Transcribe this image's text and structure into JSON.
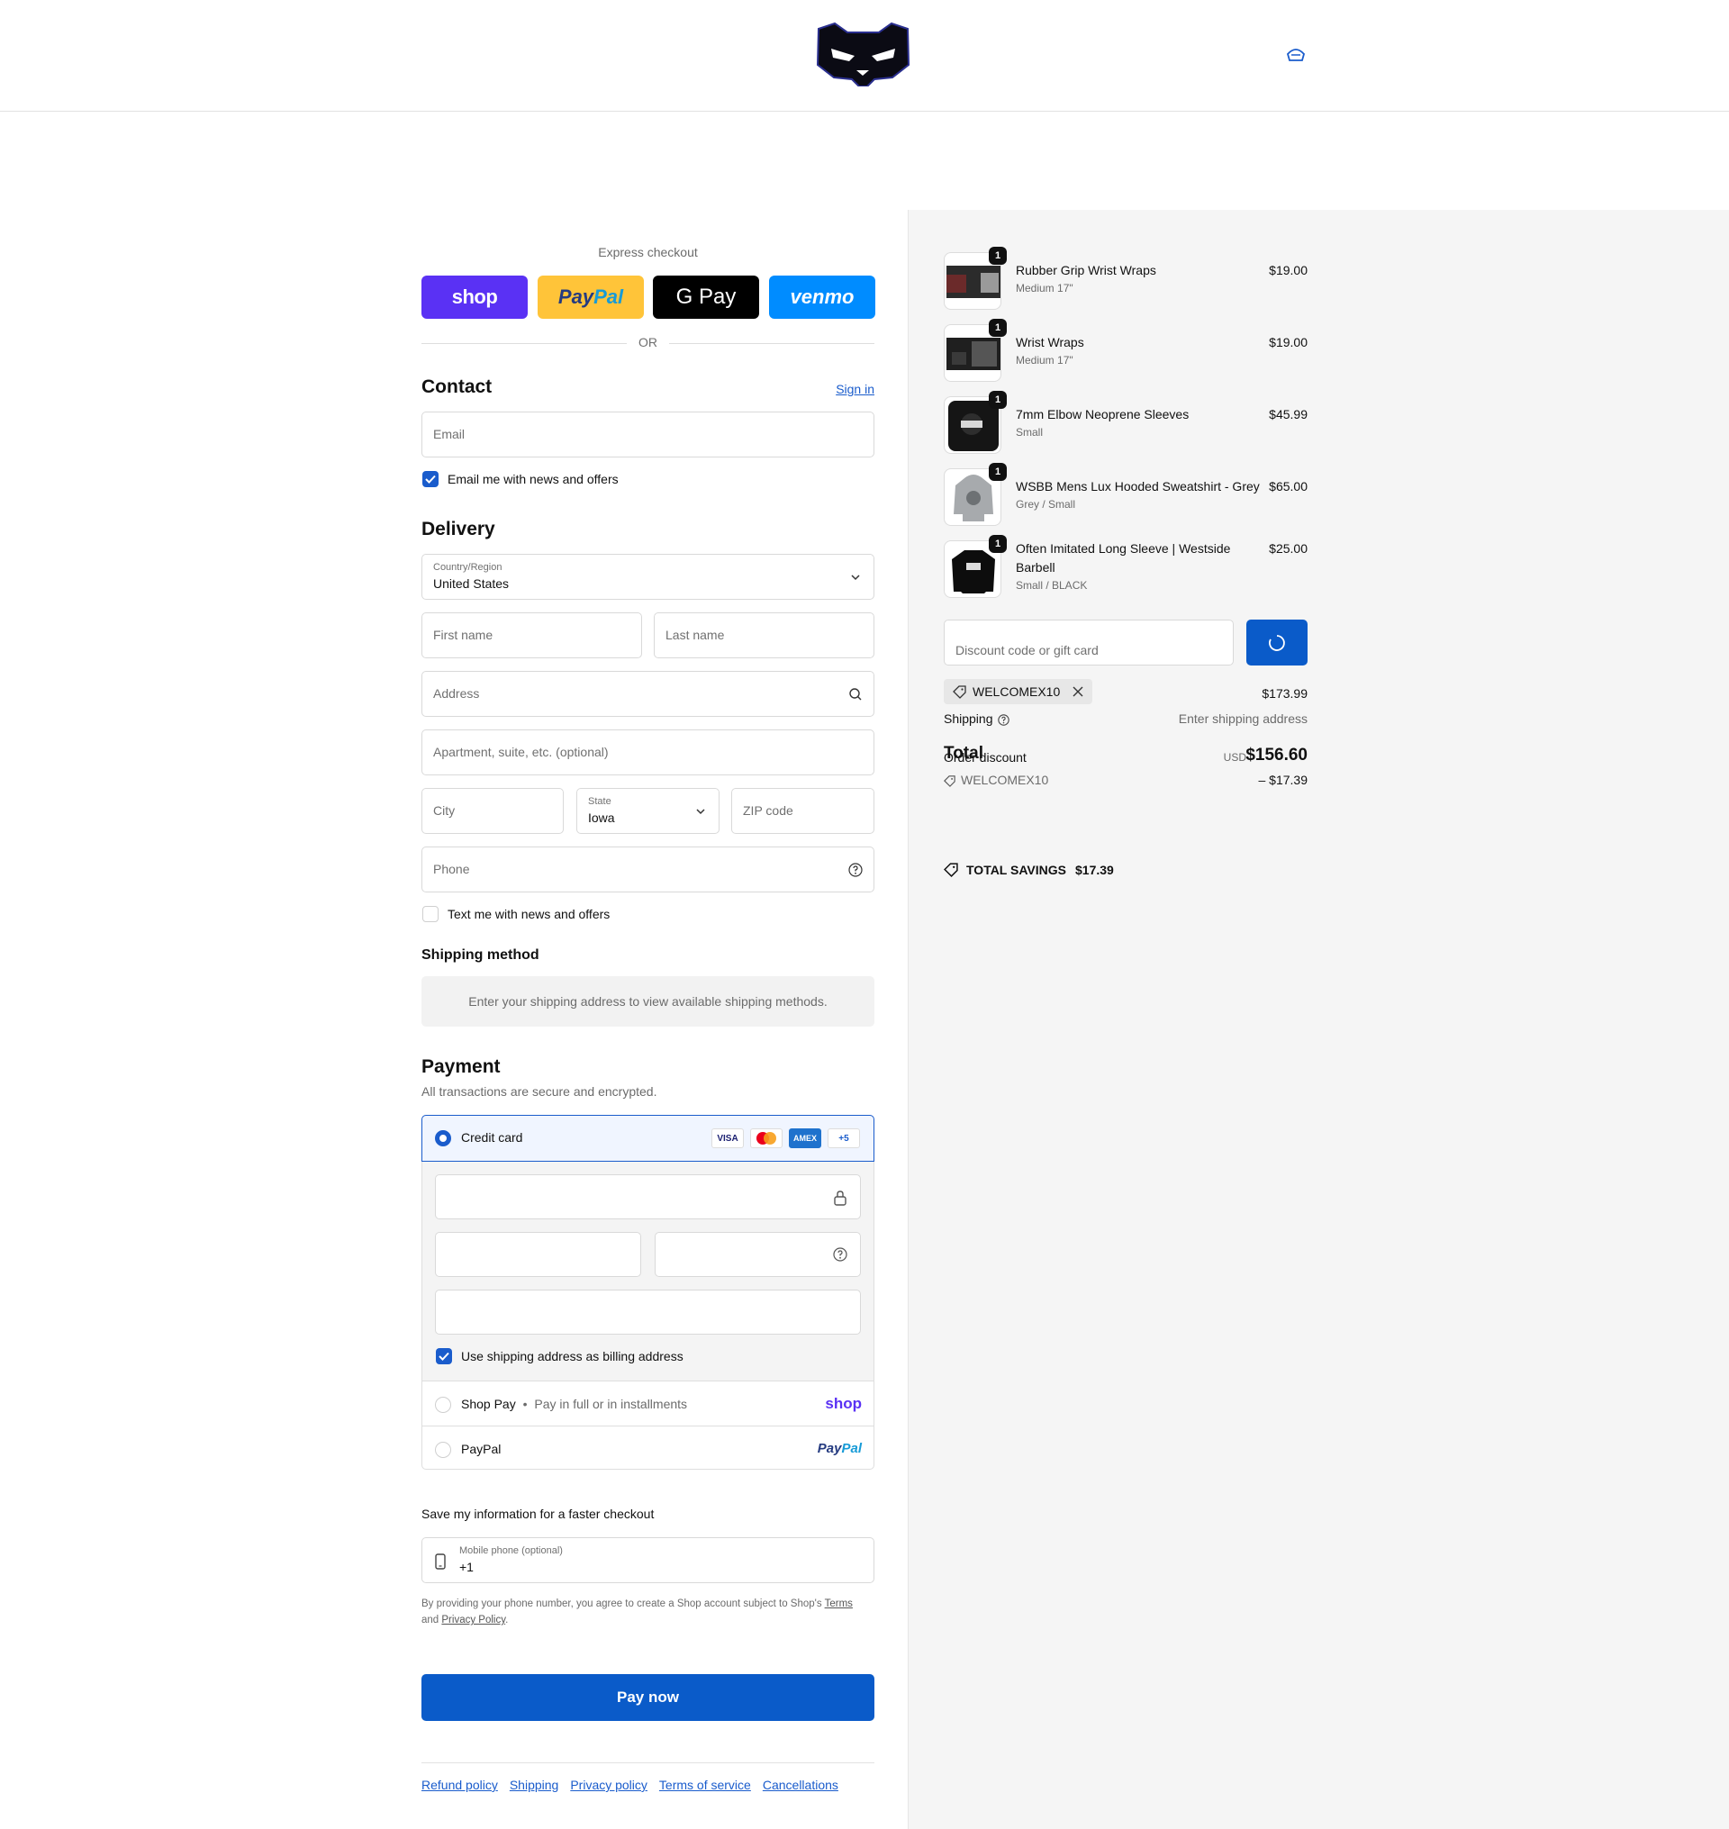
{
  "header": {
    "logo_icon": "panther-mask-logo",
    "cart_icon": "bag-icon"
  },
  "express": {
    "label": "Express checkout",
    "buttons": [
      "shop",
      "PayPal",
      "G Pay",
      "venmo"
    ],
    "or_label": "OR"
  },
  "contact": {
    "title": "Contact",
    "sign_in": "Sign in",
    "email_placeholder": "Email",
    "email_opt_in": "Email me with news and offers"
  },
  "delivery": {
    "title": "Delivery",
    "country_label": "Country/Region",
    "country_value": "United States",
    "first_name": "First name",
    "last_name": "Last name",
    "address": "Address",
    "apartment": "Apartment, suite, etc. (optional)",
    "city": "City",
    "state_label": "State",
    "state_value": "Iowa",
    "zip": "ZIP code",
    "phone": "Phone",
    "sms_opt_in": "Text me with news and offers"
  },
  "shipping_method": {
    "title": "Shipping method",
    "message": "Enter your shipping address to view available shipping methods."
  },
  "payment": {
    "title": "Payment",
    "subtitle": "All transactions are secure and encrypted.",
    "credit_card": "Credit card",
    "card_brands": [
      "VISA",
      "mastercard",
      "AMEX",
      "+5"
    ],
    "billing_same": "Use shipping address as billing address",
    "shop_pay": "Shop Pay",
    "shop_pay_sep": "•",
    "shop_pay_desc": "Pay in full or in installments",
    "shop_pay_logo": "shop",
    "paypal": "PayPal",
    "paypal_logo_1": "Pay",
    "paypal_logo_2": "Pal"
  },
  "save_info": {
    "title": "Save my information for a faster checkout",
    "phone_label": "Mobile phone (optional)",
    "phone_value": "+1",
    "legal_1": "By providing your phone number, you agree to create a Shop account subject to Shop's",
    "terms": "Terms",
    "legal_and": "and",
    "privacy": "Privacy Policy",
    "legal_end": "."
  },
  "pay_now": "Pay now",
  "footer_links": [
    "Refund policy",
    "Shipping",
    "Privacy policy",
    "Terms of service",
    "Cancellations"
  ],
  "cart": {
    "items": [
      {
        "name": "Rubber Grip Wrist Wraps",
        "variant": "Medium 17\"",
        "price": "$19.00",
        "qty": "1"
      },
      {
        "name": "Wrist Wraps",
        "variant": "Medium 17\"",
        "price": "$19.00",
        "qty": "1"
      },
      {
        "name": "7mm Elbow Neoprene Sleeves",
        "variant": "Small",
        "price": "$45.99",
        "qty": "1"
      },
      {
        "name": "WSBB Mens Lux Hooded Sweatshirt - Grey",
        "variant": "Grey / Small",
        "price": "$65.00",
        "qty": "1"
      },
      {
        "name": "Often Imitated Long Sleeve | Westside Barbell",
        "variant": "Small / BLACK",
        "price": "$25.00",
        "qty": "1"
      }
    ],
    "discount_placeholder": "Discount code or gift card",
    "applied_code": "WELCOMEX10",
    "subtotal": "$173.99",
    "shipping_label": "Shipping",
    "shipping_value": "Enter shipping address",
    "total_label": "Total",
    "order_discount_label": "Order discount",
    "currency": "USD",
    "total_value": "$156.60",
    "discount_code": "WELCOMEX10",
    "discount_value": "– $17.39",
    "savings_label": "TOTAL SAVINGS",
    "savings_value": "$17.39"
  },
  "colors": {
    "accent": "#0a5bc9",
    "shop_purple": "#5a31f4",
    "paypal_yellow": "#ffc439",
    "venmo_blue": "#008cff"
  }
}
